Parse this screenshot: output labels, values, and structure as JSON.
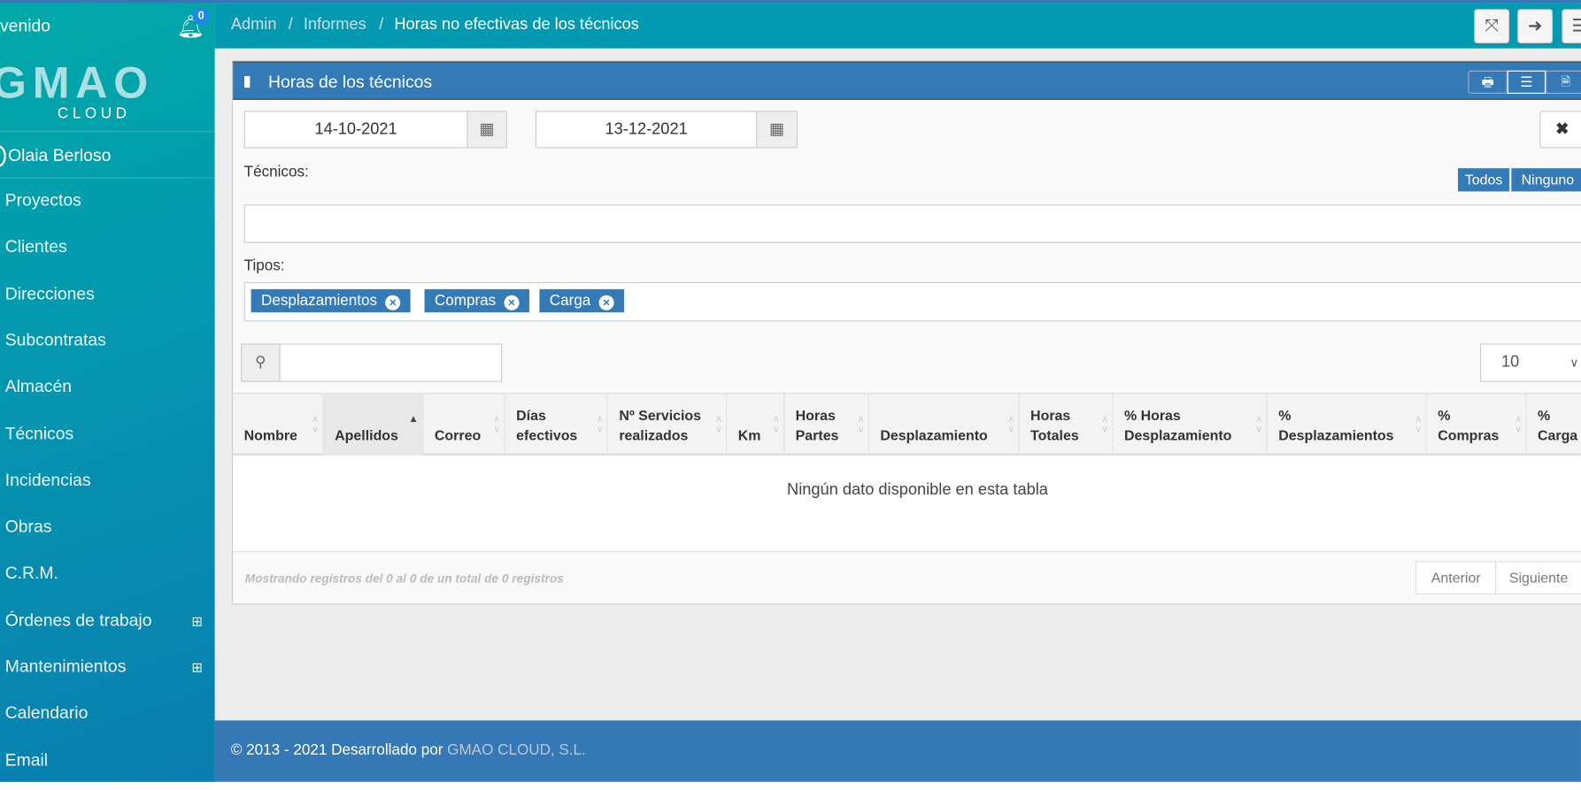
{
  "sidebar": {
    "welcome": "venido",
    "notifications": "0",
    "logo_main": "GMAO",
    "logo_sub": "CLOUD",
    "user": "Olaia Berloso",
    "items": [
      {
        "label": "Proyectos"
      },
      {
        "label": "Clientes"
      },
      {
        "label": "Direcciones"
      },
      {
        "label": "Subcontratas"
      },
      {
        "label": "Almacén"
      },
      {
        "label": "Técnicos"
      },
      {
        "label": "Incidencias"
      },
      {
        "label": "Obras"
      },
      {
        "label": "C.R.M."
      },
      {
        "label": "Órdenes de trabajo",
        "expandable": true
      },
      {
        "label": "Mantenimientos",
        "expandable": true
      },
      {
        "label": "Calendario"
      },
      {
        "label": "Email"
      }
    ]
  },
  "breadcrumb": [
    "Admin",
    "Informes",
    "Horas no efectivas de los técnicos"
  ],
  "panel": {
    "title": "Horas de los técnicos",
    "date_from": "14-10-2021",
    "date_to": "13-12-2021",
    "tecnicos_label": "Técnicos:",
    "todos": "Todos",
    "ninguno": "Ninguno",
    "tipos_label": "Tipos:",
    "tipos": [
      "Desplazamientos",
      "Compras",
      "Carga"
    ],
    "page_length": "10",
    "columns": [
      [
        "Nombre",
        ""
      ],
      [
        "Apellidos",
        ""
      ],
      [
        "Correo",
        ""
      ],
      [
        "Días",
        "efectivos"
      ],
      [
        "Nº Servicios",
        "realizados"
      ],
      [
        "Km",
        ""
      ],
      [
        "Horas",
        "Partes"
      ],
      [
        "Desplazamiento",
        ""
      ],
      [
        "Horas",
        "Totales"
      ],
      [
        "% Horas",
        "Desplazamiento"
      ],
      [
        "%",
        "Desplazamientos"
      ],
      [
        "%",
        "Compras"
      ],
      [
        "%",
        "Carga"
      ]
    ],
    "empty": "Ningún dato disponible en esta tabla",
    "info": "Mostrando registros del 0 al 0 de un total de 0 registros",
    "prev": "Anterior",
    "next": "Siguiente"
  },
  "footer": {
    "text": "© 2013 - 2021 Desarrollado por ",
    "company": "GMAO CLOUD, S.L."
  },
  "colors": {
    "primary": "#337ab7",
    "teal": "#0399b0"
  }
}
